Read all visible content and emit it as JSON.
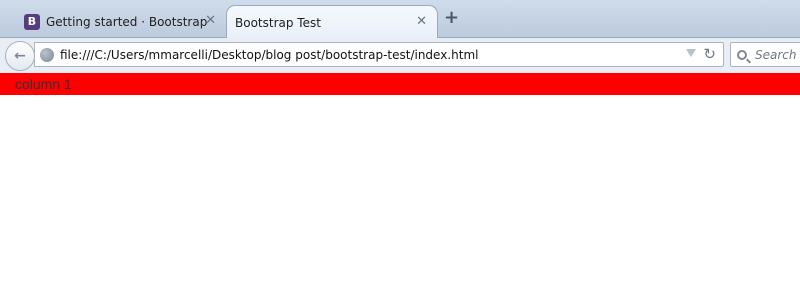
{
  "browser": {
    "tabs": [
      {
        "label": "Getting started · Bootstrap",
        "favicon_letter": "B",
        "active": false
      },
      {
        "label": "Bootstrap Test",
        "active": true
      }
    ],
    "address_bar": {
      "url": "file:///C:/Users/mmarcelli/Desktop/blog post/bootstrap-test/index.html"
    },
    "search_bar": {
      "placeholder": "Search"
    }
  },
  "page": {
    "row": {
      "background": "#ff0000",
      "column_label": "column 1"
    }
  },
  "colors": {
    "bootstrap_purple": "#563d7c",
    "accent_red": "#ff0000"
  }
}
